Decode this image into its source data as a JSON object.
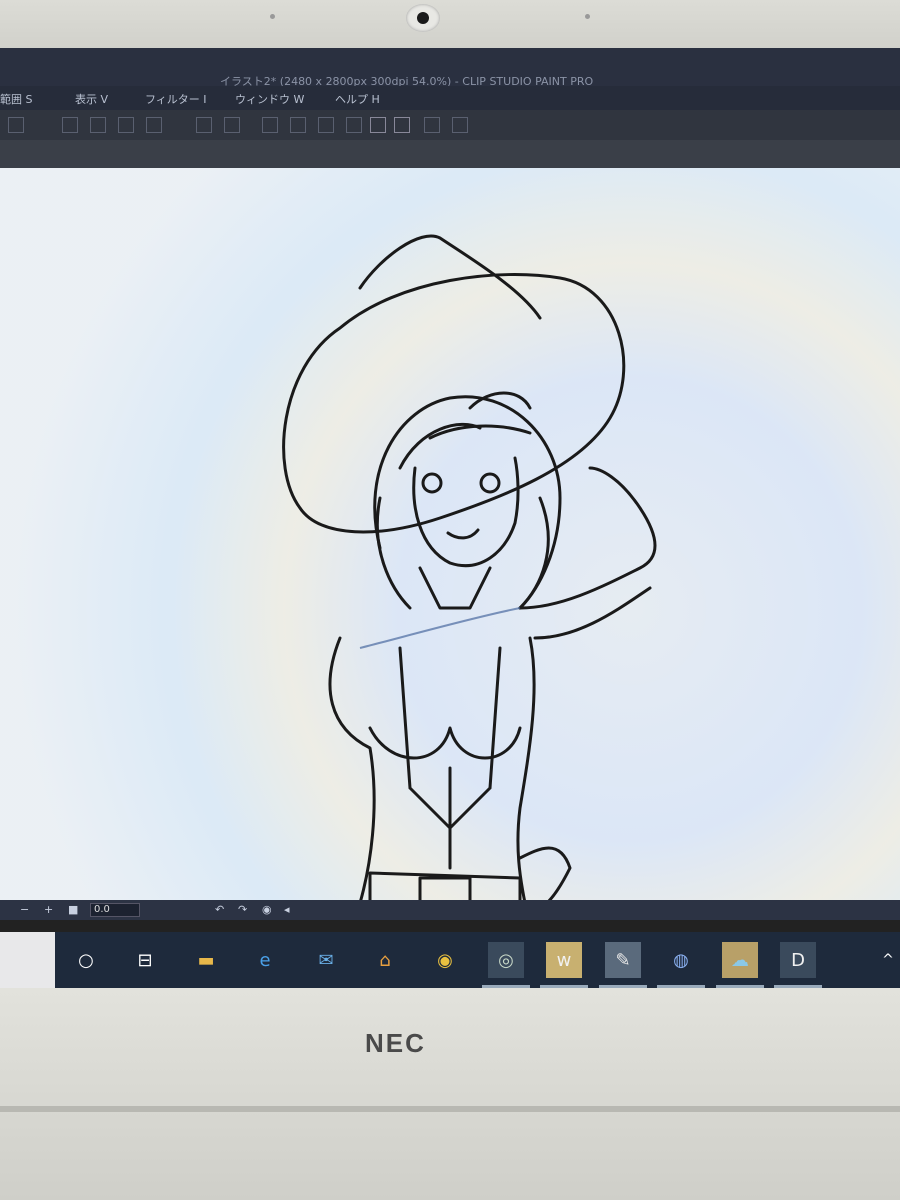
{
  "window": {
    "title": "イラスト2* (2480 x 2800px 300dpi 54.0%) - CLIP STUDIO PAINT PRO"
  },
  "menu": [
    {
      "label": "範囲 S"
    },
    {
      "label": "表示 V"
    },
    {
      "label": "フィルター I"
    },
    {
      "label": "ウィンドウ W"
    },
    {
      "label": "ヘルプ H"
    }
  ],
  "statusbar": {
    "minus": "−",
    "plus": "+",
    "zoom_value": "0.0"
  },
  "taskbar": {
    "icons": [
      {
        "name": "cortana-icon",
        "glyph": "○"
      },
      {
        "name": "task-view-icon",
        "glyph": "⊟"
      },
      {
        "name": "file-explorer-icon",
        "glyph": "▬"
      },
      {
        "name": "edge-icon",
        "glyph": "e"
      },
      {
        "name": "mail-icon",
        "glyph": "✉"
      },
      {
        "name": "store-icon",
        "glyph": "⌂"
      },
      {
        "name": "chrome-icon",
        "glyph": "◉"
      },
      {
        "name": "clip-studio-icon",
        "glyph": "◎"
      },
      {
        "name": "app-w-icon",
        "glyph": "w"
      },
      {
        "name": "clip-studio-paint-icon",
        "glyph": "✎"
      },
      {
        "name": "app-circle-icon",
        "glyph": "◍"
      },
      {
        "name": "cloud-icon",
        "glyph": "☁"
      },
      {
        "name": "app-d-icon",
        "glyph": "D"
      }
    ],
    "tray_chevron": "^"
  },
  "laptop": {
    "brand": "NEC"
  }
}
